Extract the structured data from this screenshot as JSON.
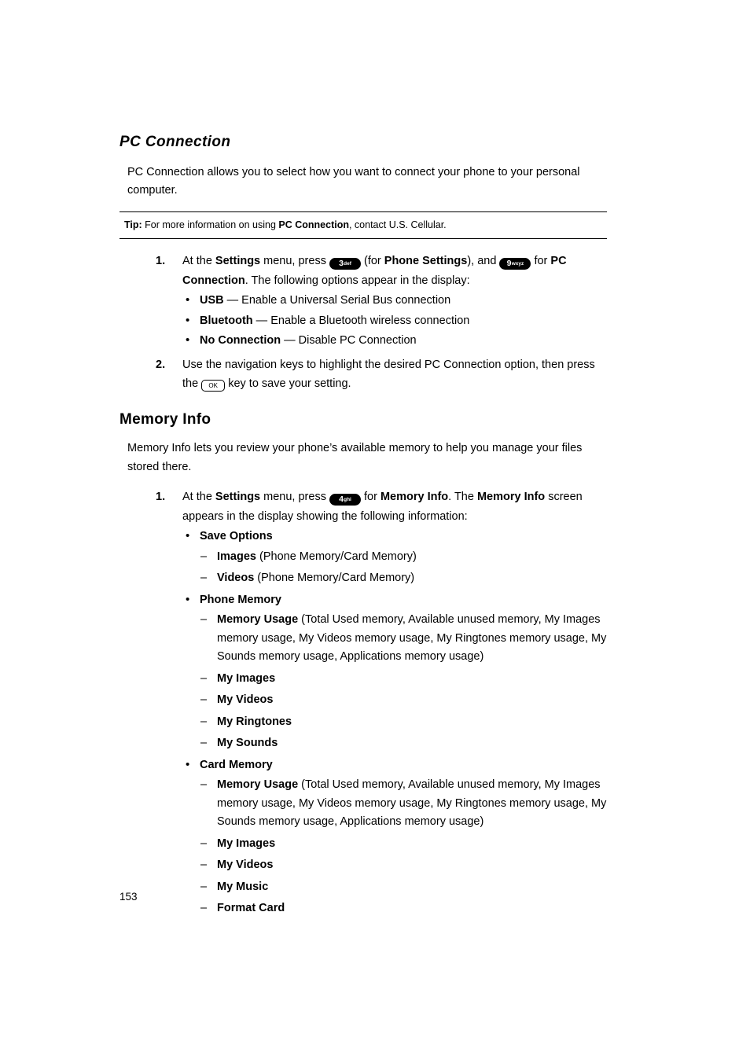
{
  "page": {
    "number": "153"
  },
  "pc_connection": {
    "heading": "PC Connection",
    "intro": "PC Connection allows you to select how you want to connect your phone to your personal computer.",
    "tip": {
      "label": "Tip:",
      "text_before": " For more information on using ",
      "bold_term": "PC Connection",
      "text_after": ", contact U.S. Cellular."
    },
    "steps": [
      {
        "num": "1.",
        "p1": "At the ",
        "b1": "Settings",
        "p2": " menu, press ",
        "key1_main": "3",
        "key1_sub": "def",
        "p3": " (for ",
        "b2": "Phone Settings",
        "p4": "), and ",
        "key2_main": "9",
        "key2_sub": "wxyz",
        "p5": " for ",
        "b3": "PC Connection",
        "p6": ". The following options appear in the display:"
      },
      {
        "num": "2.",
        "p1": "Use the navigation keys to highlight the desired PC Connection option, then press the ",
        "key_ok": "OK",
        "p2": " key to save your setting."
      }
    ],
    "options": [
      {
        "term": "USB",
        "desc": " — Enable a Universal Serial Bus connection"
      },
      {
        "term": "Bluetooth",
        "desc": " — Enable a Bluetooth wireless connection"
      },
      {
        "term": "No Connection",
        "desc": " — Disable PC Connection"
      }
    ]
  },
  "memory_info": {
    "heading": "Memory Info",
    "intro": "Memory Info lets you review your phone’s available memory to help you manage your files stored there.",
    "step": {
      "num": "1.",
      "p1": "At the ",
      "b1": "Settings",
      "p2": " menu, press ",
      "key_main": "4",
      "key_sub": "ghi",
      "p3": " for ",
      "b2": "Memory Info",
      "p4": ". The ",
      "b3": "Memory Info",
      "p5": " screen appears in the display showing the following information:"
    },
    "groups": [
      {
        "title": "Save Options",
        "items": [
          {
            "term": "Images",
            "desc": " (Phone Memory/Card Memory)"
          },
          {
            "term": "Videos",
            "desc": " (Phone Memory/Card Memory)"
          }
        ]
      },
      {
        "title": "Phone Memory",
        "items": [
          {
            "term": "Memory Usage",
            "desc": " (Total Used memory,  Available unused memory, My Images memory usage, My Videos memory usage, My Ringtones memory usage, My Sounds memory usage, Applications memory usage)"
          },
          {
            "term": "My Images",
            "desc": ""
          },
          {
            "term": "My Videos",
            "desc": ""
          },
          {
            "term": "My Ringtones",
            "desc": ""
          },
          {
            "term": "My Sounds",
            "desc": ""
          }
        ]
      },
      {
        "title": "Card Memory",
        "items": [
          {
            "term": "Memory Usage",
            "desc": " (Total Used memory, Available unused memory, My Images memory usage, My Videos memory usage, My Ringtones memory usage, My Sounds memory usage, Applications memory usage)"
          },
          {
            "term": "My Images",
            "desc": ""
          },
          {
            "term": "My Videos",
            "desc": ""
          },
          {
            "term": "My Music",
            "desc": ""
          },
          {
            "term": "Format Card",
            "desc": ""
          }
        ]
      }
    ]
  }
}
